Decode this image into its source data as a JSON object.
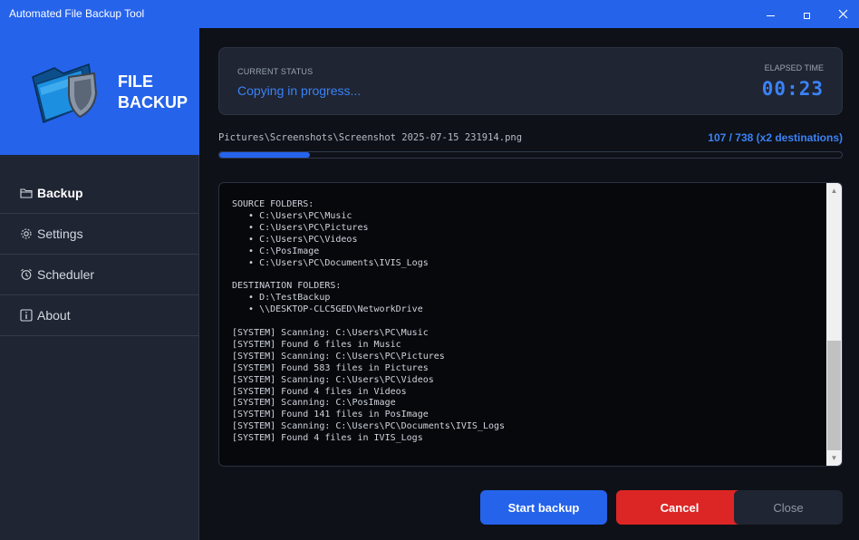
{
  "window": {
    "title": "Automated File Backup Tool",
    "controls": {
      "minimize": "minimize-icon",
      "maximize": "maximize-icon",
      "close": "close-icon"
    }
  },
  "sidebar": {
    "brand": {
      "line1": "FILE",
      "line2": "BACKUP",
      "logo": "folder-shield-logo"
    },
    "items": [
      {
        "label": "Backup",
        "icon": "folder-icon",
        "active": true
      },
      {
        "label": "Settings",
        "icon": "gear-icon",
        "active": false
      },
      {
        "label": "Scheduler",
        "icon": "alarm-clock-icon",
        "active": false
      },
      {
        "label": "About",
        "icon": "info-icon",
        "active": false
      }
    ]
  },
  "status": {
    "label": "CURRENT STATUS",
    "value": "Copying in progress...",
    "elapsed_label": "ELAPSED TIME",
    "elapsed_value": "00:23"
  },
  "progress": {
    "current_file": "Pictures\\Screenshots\\Screenshot 2025-07-15 231914.png",
    "count_text": "107 / 738 (x2 destinations)",
    "fraction": 0.145
  },
  "log": {
    "lines": [
      "SOURCE FOLDERS:",
      "   • C:\\Users\\PC\\Music",
      "   • C:\\Users\\PC\\Pictures",
      "   • C:\\Users\\PC\\Videos",
      "   • C:\\PosImage",
      "   • C:\\Users\\PC\\Documents\\IVIS_Logs",
      "",
      "DESTINATION FOLDERS:",
      "   • D:\\TestBackup",
      "   • \\\\DESKTOP-CLC5GED\\NetworkDrive",
      "",
      "[SYSTEM] Scanning: C:\\Users\\PC\\Music",
      "[SYSTEM] Found 6 files in Music",
      "[SYSTEM] Scanning: C:\\Users\\PC\\Pictures",
      "[SYSTEM] Found 583 files in Pictures",
      "[SYSTEM] Scanning: C:\\Users\\PC\\Videos",
      "[SYSTEM] Found 4 files in Videos",
      "[SYSTEM] Scanning: C:\\PosImage",
      "[SYSTEM] Found 141 files in PosImage",
      "[SYSTEM] Scanning: C:\\Users\\PC\\Documents\\IVIS_Logs",
      "[SYSTEM] Found 4 files in IVIS_Logs"
    ]
  },
  "buttons": {
    "start": "Start backup",
    "cancel": "Cancel",
    "close": "Close"
  },
  "colors": {
    "accent": "#2563eb",
    "danger": "#dc2626",
    "background": "#0e1117",
    "panel": "#1f2533"
  }
}
